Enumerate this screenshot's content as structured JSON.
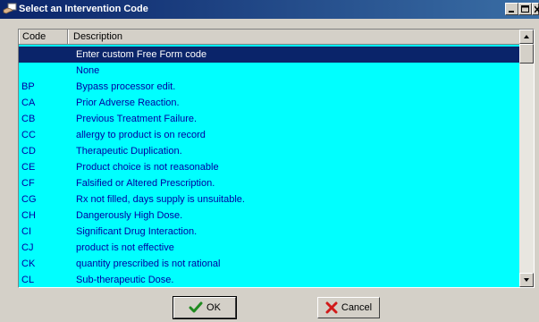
{
  "window": {
    "title": "Select an Intervention Code",
    "icon": "hand-card-icon",
    "controls": [
      "minimize-icon",
      "maximize-icon",
      "close-icon"
    ]
  },
  "list": {
    "columns": {
      "code": "Code",
      "description": "Description"
    },
    "rows": [
      {
        "code": "",
        "description": "Enter custom Free Form code",
        "selected": true
      },
      {
        "code": "",
        "description": "None"
      },
      {
        "code": "BP",
        "description": "Bypass processor edit."
      },
      {
        "code": "CA",
        "description": "Prior Adverse Reaction."
      },
      {
        "code": "CB",
        "description": "Previous Treatment Failure."
      },
      {
        "code": "CC",
        "description": "allergy to product is on record"
      },
      {
        "code": "CD",
        "description": "Therapeutic Duplication."
      },
      {
        "code": "CE",
        "description": "Product choice is not reasonable"
      },
      {
        "code": "CF",
        "description": "Falsified or Altered Prescription."
      },
      {
        "code": "CG",
        "description": "Rx not filled, days supply is unsuitable."
      },
      {
        "code": "CH",
        "description": "Dangerously High Dose."
      },
      {
        "code": "CI",
        "description": "Significant Drug Interaction."
      },
      {
        "code": "CJ",
        "description": "product is not effective"
      },
      {
        "code": "CK",
        "description": "quantity prescribed is not rational"
      },
      {
        "code": "CL",
        "description": "Sub-therapeutic Dose."
      }
    ]
  },
  "buttons": {
    "ok": {
      "label": "OK",
      "icon": "checkmark-icon"
    },
    "cancel": {
      "label": "Cancel",
      "icon": "red-x-icon"
    }
  },
  "colors": {
    "list_background": "#00ffff",
    "selected_row": "#0a246a",
    "row_text": "#0000a0",
    "title_gradient_start": "#0a246a",
    "title_gradient_end": "#3a6ea5"
  }
}
